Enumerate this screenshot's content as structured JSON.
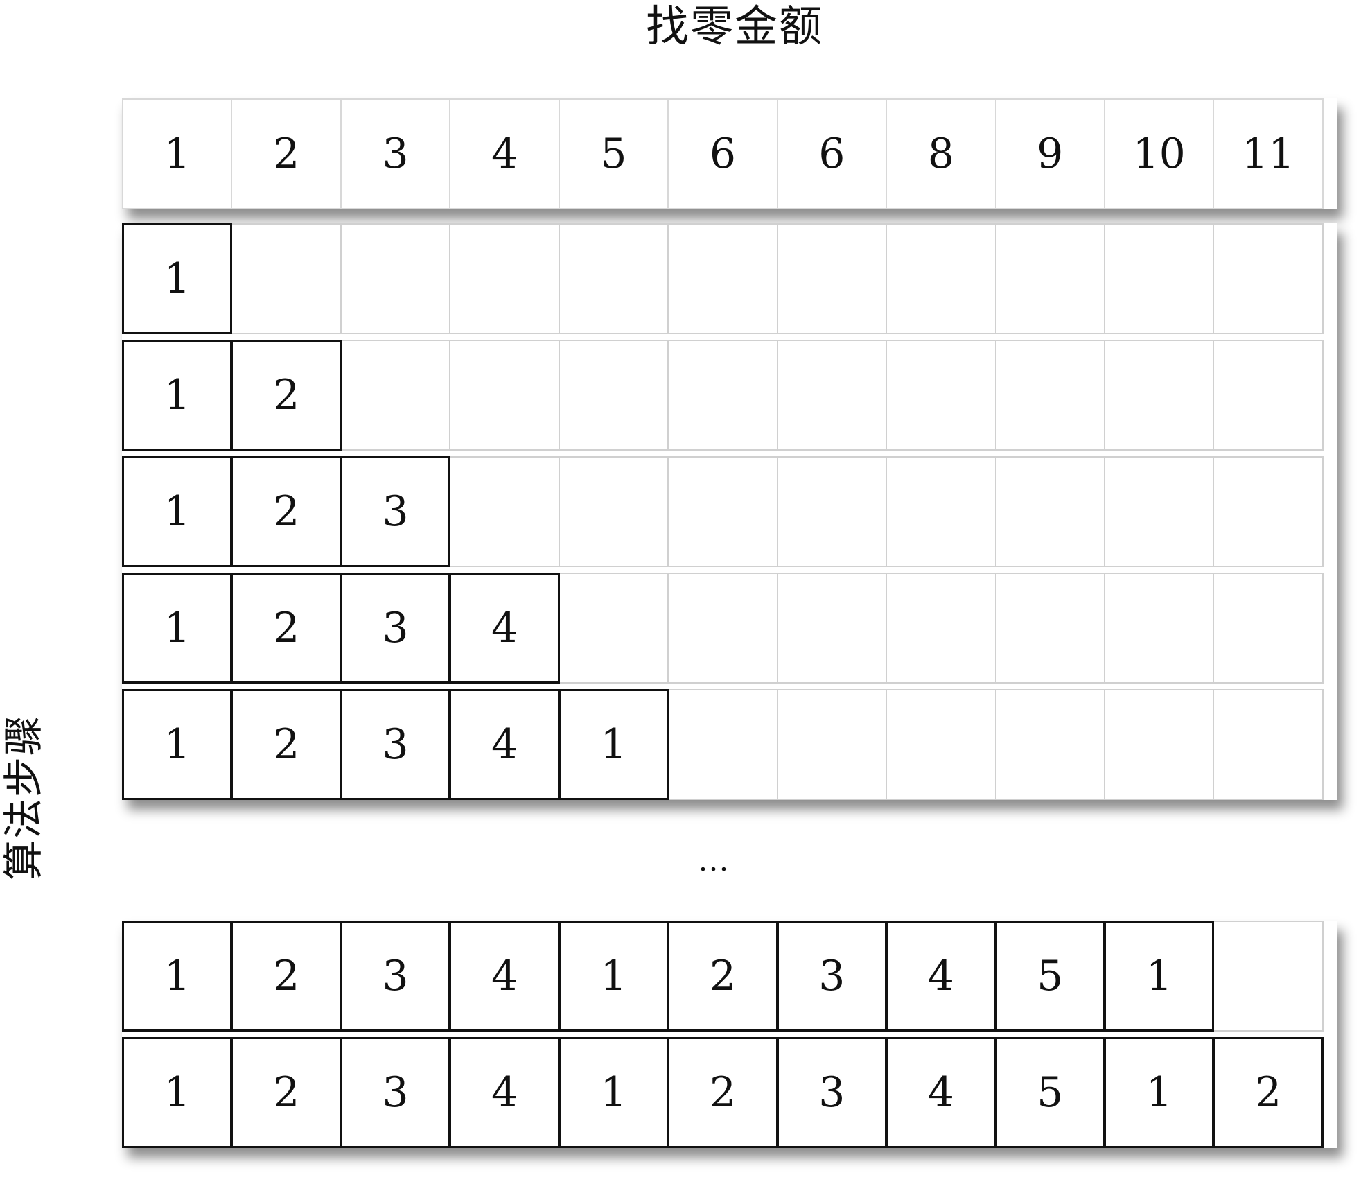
{
  "title": "找零金额",
  "side_label": "算法步骤",
  "ellipsis": "...",
  "header": [
    "1",
    "2",
    "3",
    "4",
    "5",
    "6",
    "6",
    "8",
    "9",
    "10",
    "11"
  ],
  "rows_top": [
    [
      "1"
    ],
    [
      "1",
      "2"
    ],
    [
      "1",
      "2",
      "3"
    ],
    [
      "1",
      "2",
      "3",
      "4"
    ],
    [
      "1",
      "2",
      "3",
      "4",
      "1"
    ]
  ],
  "rows_bottom": [
    [
      "1",
      "2",
      "3",
      "4",
      "1",
      "2",
      "3",
      "4",
      "5",
      "1"
    ],
    [
      "1",
      "2",
      "3",
      "4",
      "1",
      "2",
      "3",
      "4",
      "5",
      "1",
      "2"
    ]
  ],
  "columns": 11
}
